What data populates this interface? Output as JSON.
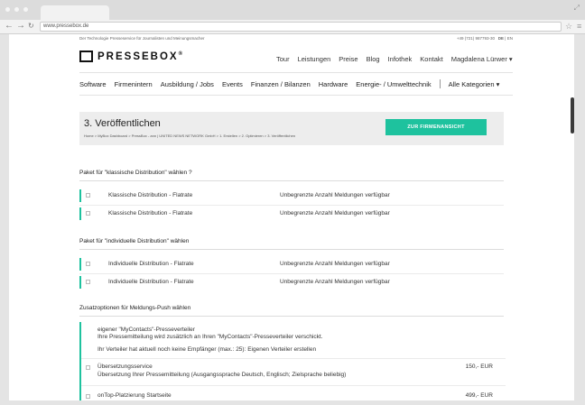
{
  "browser": {
    "url": "www.pressebox.de"
  },
  "topline": {
    "tagline": "Der Technologie Presseservice für Journalisten und Meinungsmacher",
    "phone": "+49 (721) 987793-30",
    "lang_de": "DE",
    "lang_sep": "|",
    "lang_en": "EN"
  },
  "logo": {
    "text": "PRESSEBOX",
    "reg": "®"
  },
  "mainnav": {
    "items": [
      "Tour",
      "Leistungen",
      "Preise",
      "Blog",
      "Infothek",
      "Kontakt",
      "Magdalena Lürwer ▾"
    ]
  },
  "catnav": {
    "items": [
      "Software",
      "Firmenintern",
      "Ausbildung / Jobs",
      "Events",
      "Finanzen / Bilanzen",
      "Hardware",
      "Energie- / Umwelttechnik"
    ],
    "all": "Alle Kategorien ▾"
  },
  "header": {
    "title": "3. Veröffentlichen",
    "breadcrumb": "Home > MyBox Dashboard > PressBox - ann | UNITED NEWS NETWORK GmbH > 1. Erstellen > 2. Optimieren > 3. Veröffentlichen",
    "cta_label": "ZUR FIRMENANSICHT"
  },
  "classic": {
    "heading": "Paket für \"klassische Distribution\" wählen ?",
    "rows": [
      {
        "name": "Klassische Distribution - Flatrate",
        "desc": "Unbegrenzte Anzahl Meldungen verfügbar"
      },
      {
        "name": "Klassische Distribution - Flatrate",
        "desc": "Unbegrenzte Anzahl Meldungen verfügbar"
      }
    ]
  },
  "individual": {
    "heading": "Paket für \"individuelle Distribution\" wählen",
    "rows": [
      {
        "name": "Individuelle Distribution - Flatrate",
        "desc": "Unbegrenzte Anzahl Meldungen verfügbar"
      },
      {
        "name": "Individuelle Distribution - Flatrate",
        "desc": "Unbegrenzte Anzahl Meldungen verfügbar"
      }
    ]
  },
  "addons": {
    "heading": "Zusatzoptionen für Meldungs-Push wählen",
    "mycontacts_title": "eigener \"MyContacts\"-Presseverteiler",
    "mycontacts_desc": "Ihre Pressemitteilung wird zusätzlich an Ihren \"MyContacts\"-Presseverteiler verschickt.",
    "mycontacts_note": "Ihr Verteiler hat aktuell noch keine Empfänger (max.: 25): Eigenen Verteiler erstellen",
    "translation_title": "Übersetzungsservice",
    "translation_desc": "Übersetzung Ihrer Pressemitteilung (Ausgangssprache Deutsch, Englisch; Zielsprache beliebig)",
    "translation_price": "150,- EUR",
    "ontop_title": "onTop-Platzierung Startseite",
    "ontop_price": "499,- EUR"
  },
  "colors": {
    "accent": "#1ec29e"
  }
}
